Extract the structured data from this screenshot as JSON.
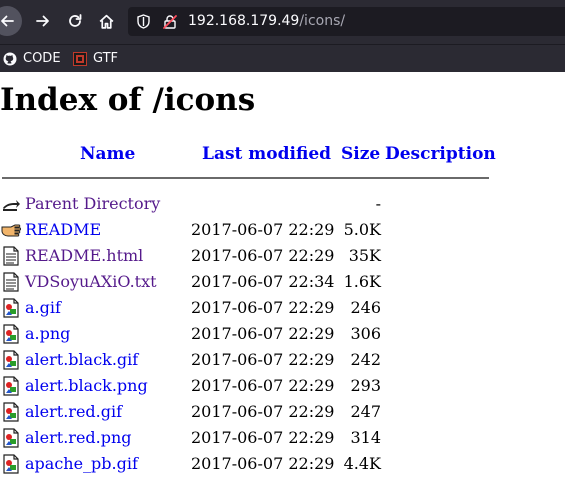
{
  "browser": {
    "url_host": "192.168.179.49",
    "url_path": "/icons/",
    "bookmarks": [
      {
        "label": "CODE",
        "icon": "github-icon"
      },
      {
        "label": "GTF",
        "icon": "gtf-favicon"
      }
    ],
    "icons": {
      "back": "arrow-left-icon",
      "forward": "arrow-right-icon",
      "reload": "reload-icon",
      "home": "home-icon",
      "shield": "shield-icon",
      "insecure": "insecure-lock-icon"
    },
    "colors": {
      "chrome_bg": "#2b2a33",
      "urlbar_bg": "#1c1b22",
      "text": "#fbfbfe"
    }
  },
  "page": {
    "title": "Index of /icons",
    "headers": {
      "name": "Name",
      "last_modified": "Last modified",
      "size": "Size",
      "description": "Description"
    },
    "colors": {
      "link": "#0000ee",
      "visited": "#551a8b"
    },
    "rows": [
      {
        "name": "Parent Directory",
        "date": "",
        "size": "-",
        "icon": "back-folder-icon",
        "visited": true
      },
      {
        "name": "README",
        "date": "2017-06-07 22:29",
        "size": "5.0K",
        "icon": "hand-icon",
        "visited": false
      },
      {
        "name": "README.html",
        "date": "2017-06-07 22:29",
        "size": "35K",
        "icon": "text-file-icon",
        "visited": true
      },
      {
        "name": "VDSoyuAXiO.txt",
        "date": "2017-06-07 22:34",
        "size": "1.6K",
        "icon": "text-file-icon",
        "visited": true
      },
      {
        "name": "a.gif",
        "date": "2017-06-07 22:29",
        "size": "246",
        "icon": "image-file-icon",
        "visited": false
      },
      {
        "name": "a.png",
        "date": "2017-06-07 22:29",
        "size": "306",
        "icon": "image-file-icon",
        "visited": false
      },
      {
        "name": "alert.black.gif",
        "date": "2017-06-07 22:29",
        "size": "242",
        "icon": "image-file-icon",
        "visited": false
      },
      {
        "name": "alert.black.png",
        "date": "2017-06-07 22:29",
        "size": "293",
        "icon": "image-file-icon",
        "visited": false
      },
      {
        "name": "alert.red.gif",
        "date": "2017-06-07 22:29",
        "size": "247",
        "icon": "image-file-icon",
        "visited": false
      },
      {
        "name": "alert.red.png",
        "date": "2017-06-07 22:29",
        "size": "314",
        "icon": "image-file-icon",
        "visited": false
      },
      {
        "name": "apache_pb.gif",
        "date": "2017-06-07 22:29",
        "size": "4.4K",
        "icon": "image-file-icon",
        "visited": false
      }
    ]
  }
}
